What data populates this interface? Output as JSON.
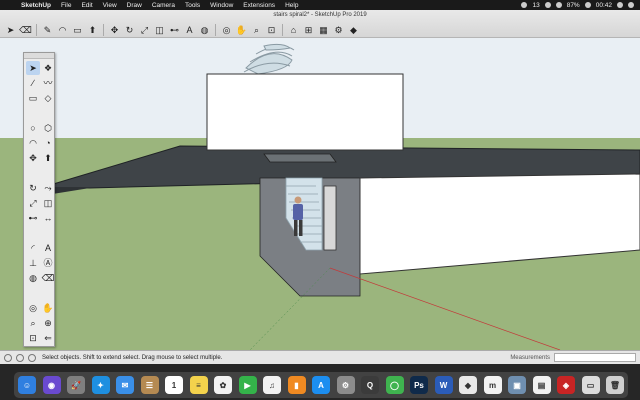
{
  "menubar": {
    "apple": "",
    "items": [
      "SketchUp",
      "File",
      "Edit",
      "View",
      "Draw",
      "Camera",
      "Tools",
      "Window",
      "Extensions",
      "Help"
    ],
    "status": {
      "notifications": "13",
      "battery": "87%",
      "clock": "00:42"
    }
  },
  "window": {
    "title": "stairs spiral2* - SketchUp Pro 2019"
  },
  "toolbar": {
    "icons": [
      "select-arrow",
      "eraser",
      "line-pencil",
      "arc",
      "rectangle",
      "push-pull",
      "move",
      "rotate",
      "scale",
      "offset",
      "tape-measure",
      "text",
      "paint-bucket",
      "orbit",
      "pan",
      "zoom",
      "zoom-extents",
      "3d-warehouse",
      "extension-warehouse",
      "layout",
      "extension-manager",
      "ruby-console"
    ]
  },
  "scene": {
    "sky": "#e9eff4",
    "ground": "#9bb57d",
    "roof": "#3f4448",
    "wall": "#ffffff",
    "inner_wall": "#7b7f84",
    "stair": "#d3e2ea"
  },
  "palette": {
    "tools": [
      "select",
      "make-component",
      "line",
      "freehand",
      "rectangle",
      "rotated-rectangle",
      "circle",
      "polygon",
      "arc",
      "pie",
      "move",
      "push-pull",
      "rotate",
      "follow-me",
      "scale",
      "offset",
      "tape-measure",
      "dimension",
      "protractor",
      "text",
      "axes",
      "3d-text",
      "paint-bucket",
      "eraser",
      "orbit",
      "pan",
      "zoom",
      "zoom-window",
      "zoom-extents",
      "previous-view",
      "position-camera",
      "walk",
      "look-around",
      "section-plane"
    ]
  },
  "statusbar": {
    "hint": "Select objects. Shift to extend select. Drag mouse to select multiple.",
    "measurements_label": "Measurements",
    "measurements_value": ""
  },
  "dock": {
    "apps": [
      {
        "name": "finder",
        "color": "#2f7fe0",
        "glyph": "☺"
      },
      {
        "name": "siri",
        "color": "#6a4ad0",
        "glyph": "◉"
      },
      {
        "name": "launchpad",
        "color": "#7f7f7f",
        "glyph": "🚀"
      },
      {
        "name": "safari",
        "color": "#1e8fe0",
        "glyph": "✦"
      },
      {
        "name": "mail",
        "color": "#3a8fe8",
        "glyph": "✉"
      },
      {
        "name": "contacts",
        "color": "#b58a52",
        "glyph": "☰"
      },
      {
        "name": "calendar",
        "color": "#ffffff",
        "glyph": "1"
      },
      {
        "name": "notes",
        "color": "#f3d24c",
        "glyph": "≡"
      },
      {
        "name": "photos",
        "color": "#f2f2f2",
        "glyph": "✿"
      },
      {
        "name": "facetime",
        "color": "#34b34a",
        "glyph": "▶"
      },
      {
        "name": "music",
        "color": "#f2f2f2",
        "glyph": "♫"
      },
      {
        "name": "books",
        "color": "#f08a22",
        "glyph": "▮"
      },
      {
        "name": "app-store",
        "color": "#1c8ef0",
        "glyph": "A"
      },
      {
        "name": "system-preferences",
        "color": "#8c8c8c",
        "glyph": "⚙"
      },
      {
        "name": "quicktime",
        "color": "#3b3b3b",
        "glyph": "Q"
      },
      {
        "name": "wechat",
        "color": "#3fb34f",
        "glyph": "◯"
      },
      {
        "name": "photoshop",
        "color": "#0f2a4a",
        "glyph": "Ps"
      },
      {
        "name": "word",
        "color": "#2b5cb8",
        "glyph": "W"
      },
      {
        "name": "sketchup",
        "color": "#e8e8e8",
        "glyph": "◆"
      },
      {
        "name": "layout",
        "color": "#f2f2f2",
        "glyph": "m"
      },
      {
        "name": "preview",
        "color": "#6f8fb0",
        "glyph": "▣"
      },
      {
        "name": "document-viewer",
        "color": "#f2f2f2",
        "glyph": "▤"
      },
      {
        "name": "pdf-reader",
        "color": "#c82424",
        "glyph": "◈"
      },
      {
        "name": "downloads",
        "color": "#dcdcdc",
        "glyph": "▭"
      },
      {
        "name": "trash",
        "color": "#cfcfcf",
        "glyph": "🗑"
      }
    ]
  }
}
